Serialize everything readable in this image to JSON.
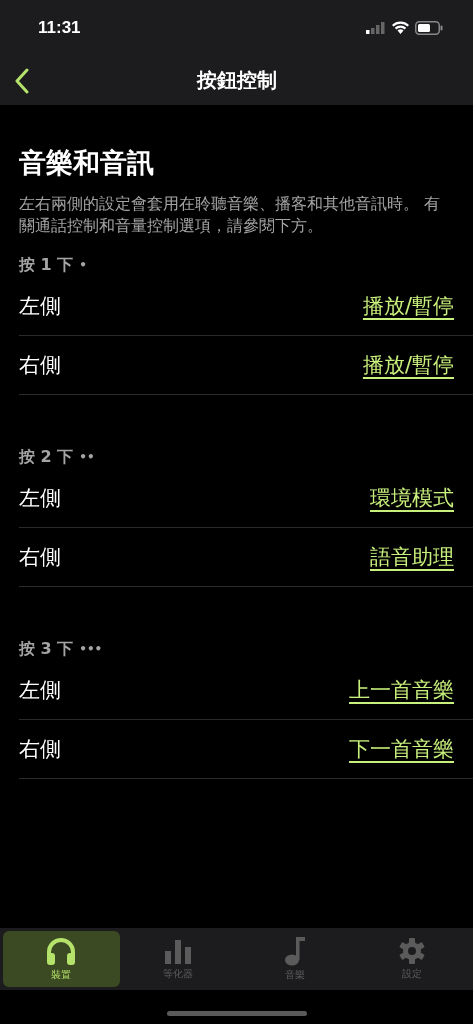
{
  "status_bar": {
    "time": "11:31"
  },
  "nav": {
    "title": "按鈕控制"
  },
  "section": {
    "title": "音樂和音訊",
    "description": "左右兩側的設定會套用在聆聽音樂、播客和其他音訊時。 有關通話控制和音量控制選項，請參閱下方。"
  },
  "groups": [
    {
      "label": "按 1 下",
      "dots": "•",
      "rows": [
        {
          "side": "左側",
          "action": "播放/暫停"
        },
        {
          "side": "右側",
          "action": "播放/暫停"
        }
      ]
    },
    {
      "label": "按 2 下",
      "dots": "••",
      "rows": [
        {
          "side": "左側",
          "action": "環境模式"
        },
        {
          "side": "右側",
          "action": "語音助理"
        }
      ]
    },
    {
      "label": "按 3 下",
      "dots": "•••",
      "rows": [
        {
          "side": "左側",
          "action": "上一首音樂"
        },
        {
          "side": "右側",
          "action": "下一首音樂"
        }
      ]
    }
  ],
  "tabs": [
    {
      "kind": "headphones",
      "label": "裝置",
      "selected": true
    },
    {
      "kind": "equalizer",
      "label": "等化器",
      "selected": false
    },
    {
      "kind": "music",
      "label": "音樂",
      "selected": false
    },
    {
      "kind": "settings",
      "label": "設定",
      "selected": false
    }
  ]
}
